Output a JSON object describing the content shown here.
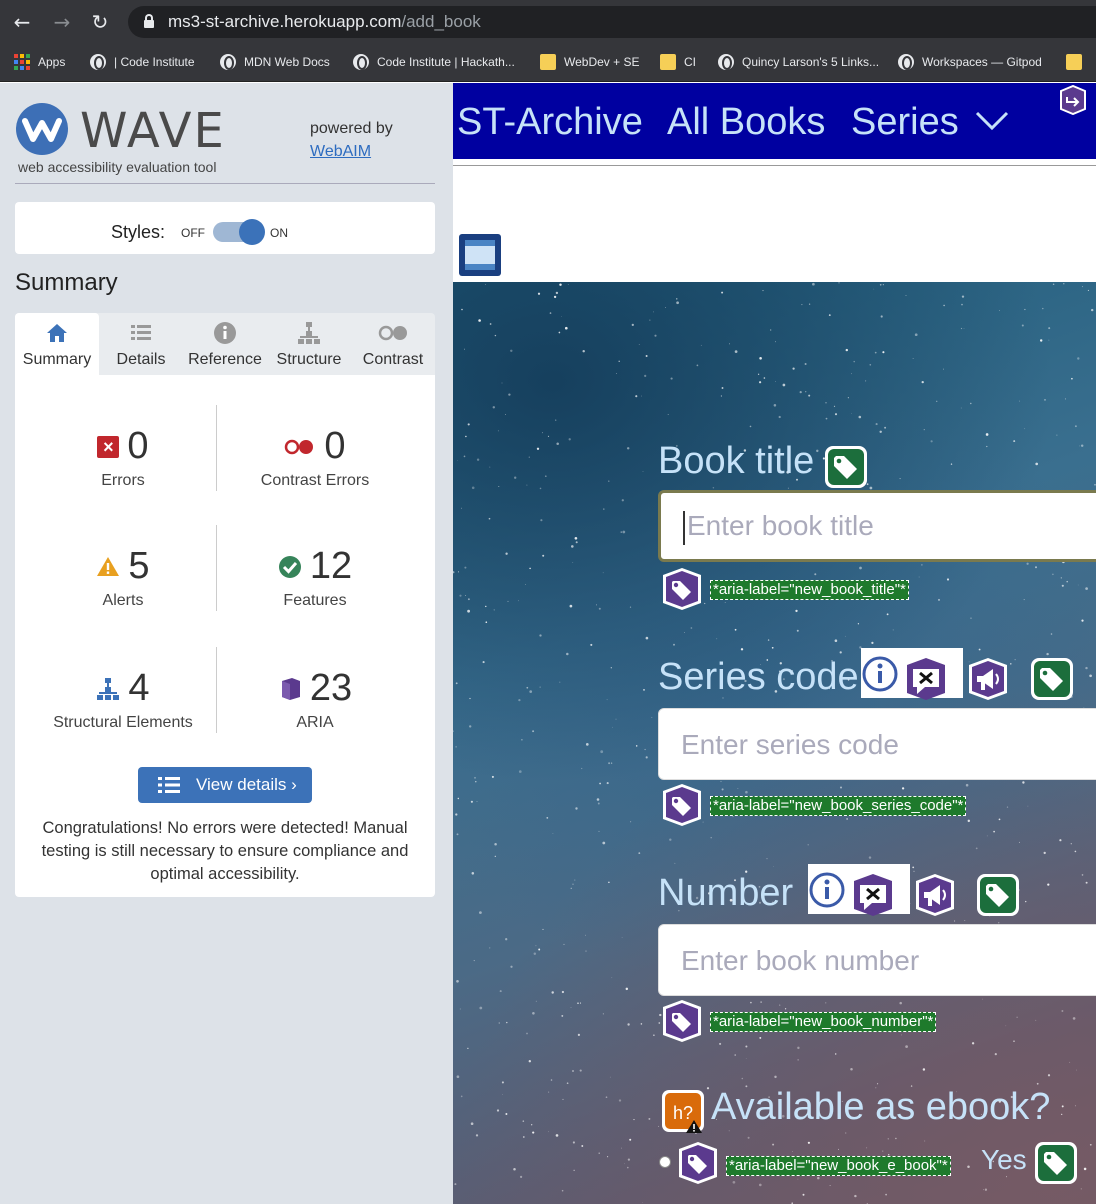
{
  "browser": {
    "url_host": "ms3-st-archive.herokuapp.com",
    "url_path": "/add_book",
    "bookmarks": [
      {
        "label": "Apps",
        "icon": "apps-grid-icon"
      },
      {
        "label": "| Code Institute",
        "icon": "globe-icon"
      },
      {
        "label": "MDN Web Docs",
        "icon": "globe-icon"
      },
      {
        "label": "Code Institute | Hackath...",
        "icon": "globe-icon"
      },
      {
        "label": "WebDev + SE",
        "icon": "folder-icon"
      },
      {
        "label": "CI",
        "icon": "folder-icon"
      },
      {
        "label": "Quincy Larson's 5 Links...",
        "icon": "globe-icon"
      },
      {
        "label": "Workspaces — Gitpod",
        "icon": "globe-icon"
      }
    ]
  },
  "wave": {
    "title": "WAVE",
    "subtitle": "web accessibility evaluation tool",
    "powered_by": "powered by",
    "webaim": "WebAIM",
    "styles_label": "Styles:",
    "off": "OFF",
    "on": "ON",
    "styles_on": true,
    "section_title": "Summary",
    "tabs": [
      {
        "label": "Summary",
        "icon": "home-icon"
      },
      {
        "label": "Details",
        "icon": "list-icon"
      },
      {
        "label": "Reference",
        "icon": "info-icon"
      },
      {
        "label": "Structure",
        "icon": "hierarchy-icon"
      },
      {
        "label": "Contrast",
        "icon": "contrast-icon"
      }
    ],
    "stats": {
      "errors": {
        "value": "0",
        "label": "Errors"
      },
      "contrast_errors": {
        "value": "0",
        "label": "Contrast Errors"
      },
      "alerts": {
        "value": "5",
        "label": "Alerts"
      },
      "features": {
        "value": "12",
        "label": "Features"
      },
      "structural": {
        "value": "4",
        "label": "Structural Elements"
      },
      "aria": {
        "value": "23",
        "label": "ARIA"
      }
    },
    "view_details": "View details ›",
    "congrats": "Congratulations! No errors were detected! Manual testing is still necessary to ensure compliance and optimal accessibility."
  },
  "site": {
    "brand": "ST-Archive",
    "nav": [
      "All Books",
      "Series"
    ],
    "fields": {
      "title": {
        "label": "Book title",
        "placeholder": "Enter book title",
        "aria": "*aria-label=\"new_book_title\"*"
      },
      "series": {
        "label": "Series code",
        "placeholder": "Enter series code",
        "aria": "*aria-label=\"new_book_series_code\"*"
      },
      "number": {
        "label": "Number",
        "placeholder": "Enter book number",
        "aria": "*aria-label=\"new_book_number\"*"
      },
      "ebook": {
        "label": "Available as ebook?",
        "aria": "*aria-label=\"new_book_e_book\"*",
        "option": "Yes"
      }
    }
  },
  "colors": {
    "wave_blue": "#3c72b8",
    "site_nav": "#0000a0",
    "error_red": "#c1272d",
    "feature_green": "#36845a",
    "aria_purple": "#5b3a8e"
  }
}
